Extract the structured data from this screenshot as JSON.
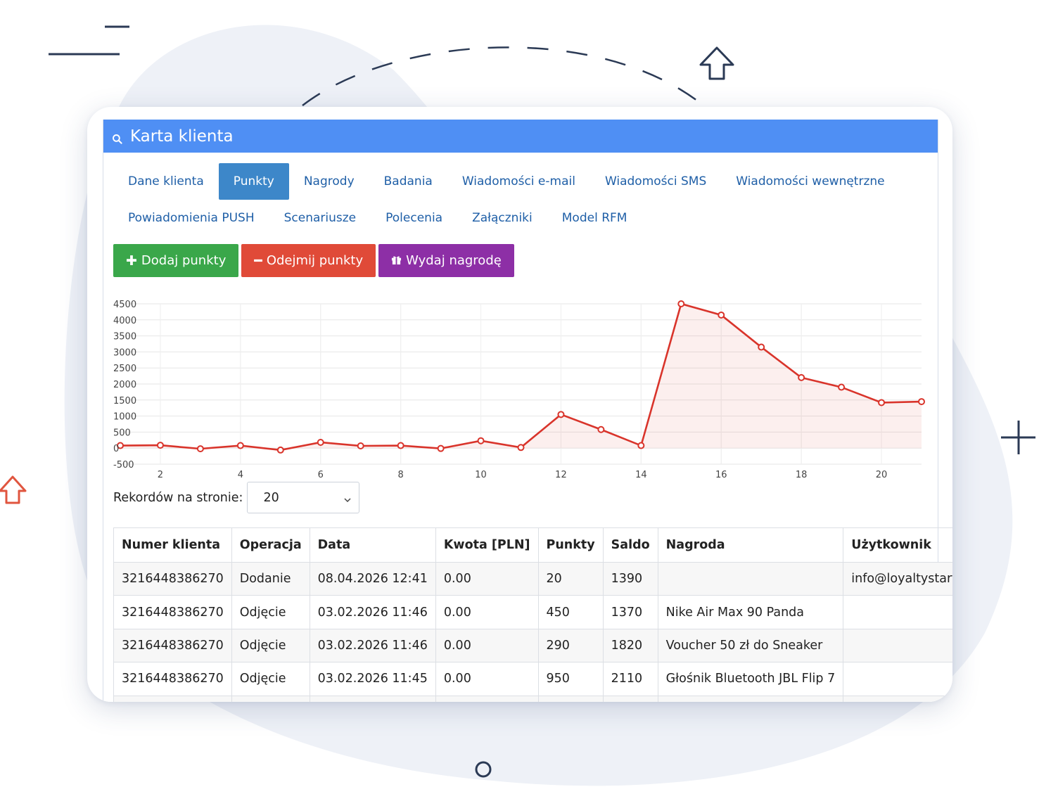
{
  "window": {
    "title": "Karta klienta",
    "title_icon": "search-icon"
  },
  "tabs": {
    "row1": [
      {
        "label": "Dane klienta",
        "active": false
      },
      {
        "label": "Punkty",
        "active": true
      },
      {
        "label": "Nagrody",
        "active": false
      },
      {
        "label": "Badania",
        "active": false
      },
      {
        "label": "Wiadomości e-mail",
        "active": false
      },
      {
        "label": "Wiadomości SMS",
        "active": false
      },
      {
        "label": "Wiadomości wewnętrzne",
        "active": false
      }
    ],
    "row2": [
      {
        "label": "Powiadomienia PUSH",
        "active": false
      },
      {
        "label": "Scenariusze",
        "active": false
      },
      {
        "label": "Polecenia",
        "active": false
      },
      {
        "label": "Załączniki",
        "active": false
      },
      {
        "label": "Model RFM",
        "active": false
      }
    ]
  },
  "actions": {
    "add": {
      "label": "Dodaj punkty",
      "icon": "plus-icon",
      "color": "#3aa74a"
    },
    "subtract": {
      "label": "Odejmij punkty",
      "icon": "minus-icon",
      "color": "#e04a38"
    },
    "reward": {
      "label": "Wydaj nagrodę",
      "icon": "gift-icon",
      "color": "#8d2fa6"
    }
  },
  "chart_data": {
    "type": "area",
    "x": [
      1,
      2,
      3,
      4,
      5,
      6,
      7,
      8,
      9,
      10,
      11,
      12,
      13,
      14,
      15,
      16,
      17,
      18,
      19,
      20,
      21
    ],
    "series": [
      {
        "values": [
          80,
          90,
          -20,
          80,
          -60,
          180,
          70,
          80,
          -10,
          230,
          20,
          1050,
          580,
          80,
          4500,
          4150,
          3150,
          2200,
          1900,
          1420,
          1450
        ],
        "color": "#d9342b"
      }
    ],
    "x_ticks": [
      2,
      4,
      6,
      8,
      10,
      12,
      14,
      16,
      18,
      20
    ],
    "y_ticks": [
      -500,
      0,
      500,
      1000,
      1500,
      2000,
      2500,
      3000,
      3500,
      4000,
      4500
    ],
    "xlim": [
      1,
      21
    ],
    "ylim": [
      -500,
      4500
    ],
    "grid": true,
    "title": "",
    "xlabel": "",
    "ylabel": ""
  },
  "pagination": {
    "label": "Rekordów na stronie:",
    "value": "20"
  },
  "table": {
    "headers": [
      "Numer klienta",
      "Operacja",
      "Data",
      "Kwota [PLN]",
      "Punkty",
      "Saldo",
      "Nagroda",
      "Użytkownik"
    ],
    "rows": [
      [
        "3216448386270",
        "Dodanie",
        "08.04.2026 12:41",
        "0.00",
        "20",
        "1390",
        "",
        "info@loyaltystarter.io"
      ],
      [
        "3216448386270",
        "Odjęcie",
        "03.02.2026 11:46",
        "0.00",
        "450",
        "1370",
        "Nike Air Max 90 Panda",
        ""
      ],
      [
        "3216448386270",
        "Odjęcie",
        "03.02.2026 11:46",
        "0.00",
        "290",
        "1820",
        "Voucher 50 zł do Sneaker",
        ""
      ],
      [
        "3216448386270",
        "Odjęcie",
        "03.02.2026 11:45",
        "0.00",
        "950",
        "2110",
        "Głośnik Bluetooth JBL Flip 7",
        ""
      ],
      [
        "",
        "",
        "",
        "",
        "",
        "",
        "",
        ""
      ]
    ]
  }
}
